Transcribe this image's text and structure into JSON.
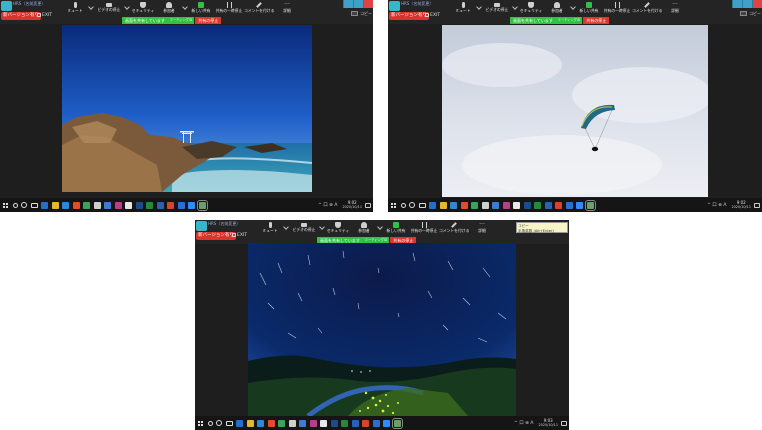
{
  "zoom": {
    "meeting_title": "HRS（名前変更）",
    "new_version_label": "新バージョン有り",
    "exit_label": "EXIT",
    "toolbar": [
      {
        "id": "mute",
        "label": "ミュート",
        "icon": "microphone-icon"
      },
      {
        "id": "video",
        "label": "ビデオの停止",
        "icon": "video-camera-icon"
      },
      {
        "id": "security",
        "label": "セキュリティ",
        "icon": "shield-icon"
      },
      {
        "id": "participants",
        "label": "参加者",
        "icon": "participants-icon",
        "count": "1"
      },
      {
        "id": "new-share",
        "label": "新しい共有",
        "icon": "share-screen-icon"
      },
      {
        "id": "pause-share",
        "label": "共有の一時停止",
        "icon": "pause-icon"
      },
      {
        "id": "annotate",
        "label": "コメントを付ける",
        "icon": "pen-icon"
      },
      {
        "id": "more",
        "label": "詳細",
        "icon": "more-dots-icon"
      }
    ],
    "share_status_text": "画面を共有しています",
    "share_meeting_id": "ミーティングID",
    "stop_share_label": "共有の停止",
    "copy_label": "コピー",
    "ime_label": "コピー",
    "ime_text": "半角英数 (Alt+Enter)",
    "accent_green": "#2fc243",
    "stop_red": "#e0342c"
  },
  "taskbar": {
    "tray_symbols": "^ 口 ⊕ A",
    "ime_indicator": "A"
  },
  "screens": [
    {
      "photo": "coastal-rocks-torii-photo",
      "clock_time": "9:02",
      "clock_date": "2020/10/11"
    },
    {
      "photo": "paraglider-sky-photo",
      "clock_time": "9:02",
      "clock_date": "2020/10/11"
    },
    {
      "photo": "star-trails-night-photo",
      "clock_time": "9:03",
      "clock_date": "2020/10/11"
    }
  ]
}
